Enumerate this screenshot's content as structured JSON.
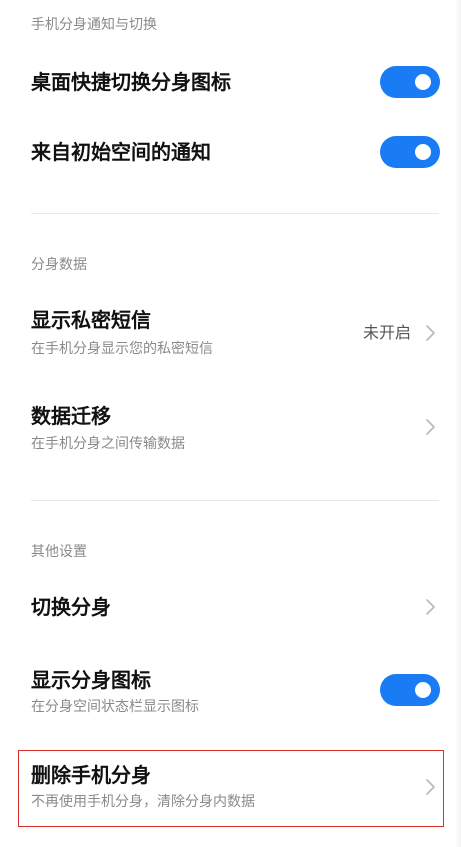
{
  "section_notify": {
    "header": "手机分身通知与切换",
    "desktop_switch": {
      "title": "桌面快捷切换分身图标",
      "enabled": true
    },
    "origin_notify": {
      "title": "来自初始空间的通知",
      "enabled": true
    }
  },
  "section_data": {
    "header": "分身数据",
    "private_sms": {
      "title": "显示私密短信",
      "subtitle": "在手机分身显示您的私密短信",
      "value": "未开启"
    },
    "data_migrate": {
      "title": "数据迁移",
      "subtitle": "在手机分身之间传输数据"
    }
  },
  "section_other": {
    "header": "其他设置",
    "switch_profile": {
      "title": "切换分身"
    },
    "show_icon": {
      "title": "显示分身图标",
      "subtitle": "在分身空间状态栏显示图标",
      "enabled": true
    },
    "delete_profile": {
      "title": "删除手机分身",
      "subtitle": "不再使用手机分身，清除分身内数据"
    }
  },
  "colors": {
    "toggle_on": "#1a7cf5",
    "highlight_border": "#d9302c"
  },
  "icons": {
    "chevron": "chevron-right-icon",
    "toggle_knob": "toggle-knob"
  }
}
